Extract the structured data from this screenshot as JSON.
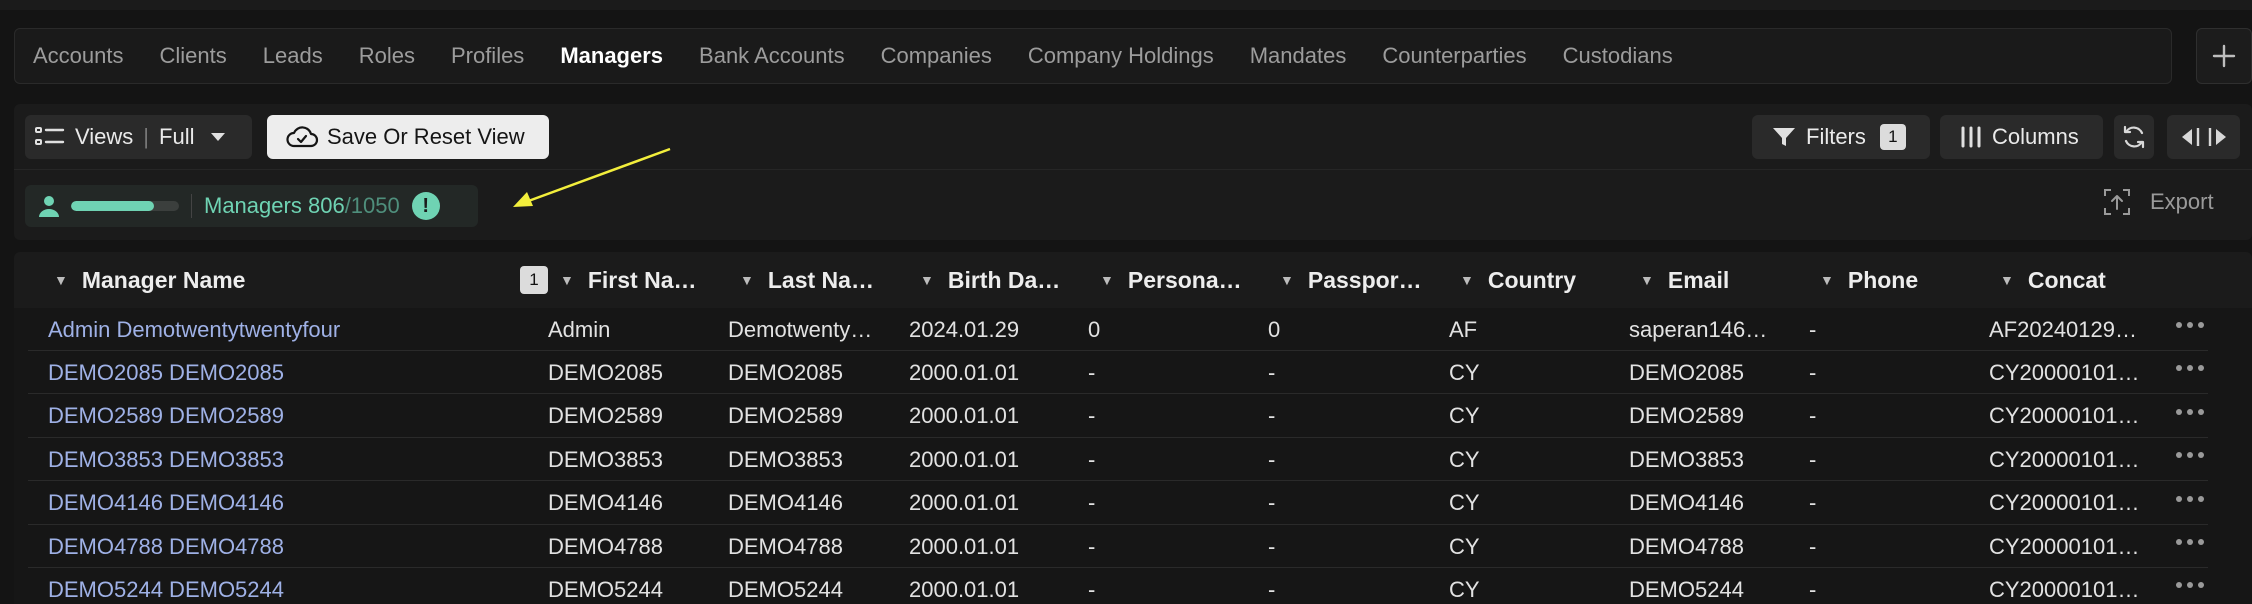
{
  "tabs": [
    {
      "label": "Accounts",
      "active": false
    },
    {
      "label": "Clients",
      "active": false
    },
    {
      "label": "Leads",
      "active": false
    },
    {
      "label": "Roles",
      "active": false
    },
    {
      "label": "Profiles",
      "active": false
    },
    {
      "label": "Managers",
      "active": true
    },
    {
      "label": "Bank Accounts",
      "active": false
    },
    {
      "label": "Companies",
      "active": false
    },
    {
      "label": "Company Holdings",
      "active": false
    },
    {
      "label": "Mandates",
      "active": false
    },
    {
      "label": "Counterparties",
      "active": false
    },
    {
      "label": "Custodians",
      "active": false
    }
  ],
  "toolbar": {
    "views_label": "Views",
    "views_value": "Full",
    "save_view_label": "Save Or Reset View",
    "filters_label": "Filters",
    "filters_count": "1",
    "columns_label": "Columns",
    "export_label": "Export"
  },
  "count": {
    "label": "Managers",
    "shown": "806",
    "total": "/1050",
    "fraction": 0.768,
    "warning_glyph": "!"
  },
  "colors": {
    "accent": "#6fd3b3",
    "link": "#9fb1e6",
    "annotation_arrow": "#f2ee3c"
  },
  "table": {
    "sort_badge": "1",
    "columns": [
      "Manager Name",
      "First Na…",
      "Last Na…",
      "Birth Da…",
      "Persona…",
      "Passpor…",
      "Country",
      "Email",
      "Phone",
      "Concat"
    ],
    "rows": [
      [
        "Admin Demotwentytwentyfour",
        "Admin",
        "Demotwenty…",
        "2024.01.29",
        "0",
        "0",
        "AF",
        "saperan146…",
        "-",
        "AF20240129…"
      ],
      [
        "DEMO2085 DEMO2085",
        "DEMO2085",
        "DEMO2085",
        "2000.01.01",
        "-",
        "-",
        "CY",
        "DEMO2085",
        "-",
        "CY20000101…"
      ],
      [
        "DEMO2589 DEMO2589",
        "DEMO2589",
        "DEMO2589",
        "2000.01.01",
        "-",
        "-",
        "CY",
        "DEMO2589",
        "-",
        "CY20000101…"
      ],
      [
        "DEMO3853 DEMO3853",
        "DEMO3853",
        "DEMO3853",
        "2000.01.01",
        "-",
        "-",
        "CY",
        "DEMO3853",
        "-",
        "CY20000101…"
      ],
      [
        "DEMO4146 DEMO4146",
        "DEMO4146",
        "DEMO4146",
        "2000.01.01",
        "-",
        "-",
        "CY",
        "DEMO4146",
        "-",
        "CY20000101…"
      ],
      [
        "DEMO4788 DEMO4788",
        "DEMO4788",
        "DEMO4788",
        "2000.01.01",
        "-",
        "-",
        "CY",
        "DEMO4788",
        "-",
        "CY20000101…"
      ],
      [
        "DEMO5244 DEMO5244",
        "DEMO5244",
        "DEMO5244",
        "2000.01.01",
        "-",
        "-",
        "CY",
        "DEMO5244",
        "-",
        "CY20000101…"
      ]
    ]
  }
}
